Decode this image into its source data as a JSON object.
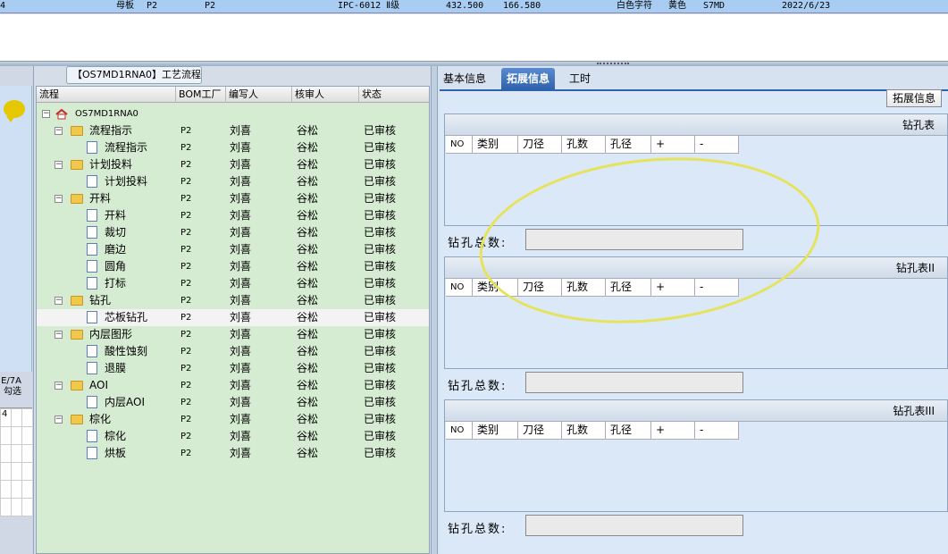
{
  "top_row": {
    "c0": "4",
    "c1": "母板",
    "c2": "P2",
    "c3": "P2",
    "c4": "IPC-6012 Ⅱ级",
    "c5": "432.500",
    "c6": "166.580",
    "c7": "白色字符",
    "c8": "黄色",
    "c9": "S7MD",
    "c10": "2022/6/23"
  },
  "left_edge": {
    "label_line1": "E/7A",
    "label_line2": "勾选",
    "grid_header": "4"
  },
  "tree": {
    "title": "【OS7MD1RNA0】工艺流程",
    "columns": [
      "流程",
      "BOM工厂",
      "编写人",
      "核审人",
      "状态"
    ],
    "root": "OS7MD1RNA0",
    "rows": [
      {
        "level": 1,
        "name": "流程指示",
        "bom": "P2",
        "writer": "刘喜",
        "reviewer": "谷松",
        "status": "已审核"
      },
      {
        "level": 2,
        "name": "流程指示",
        "bom": "P2",
        "writer": "刘喜",
        "reviewer": "谷松",
        "status": "已审核"
      },
      {
        "level": 1,
        "name": "计划投料",
        "bom": "P2",
        "writer": "刘喜",
        "reviewer": "谷松",
        "status": "已审核"
      },
      {
        "level": 2,
        "name": "计划投料",
        "bom": "P2",
        "writer": "刘喜",
        "reviewer": "谷松",
        "status": "已审核"
      },
      {
        "level": 1,
        "name": "开料",
        "bom": "P2",
        "writer": "刘喜",
        "reviewer": "谷松",
        "status": "已审核"
      },
      {
        "level": 2,
        "name": "开料",
        "bom": "P2",
        "writer": "刘喜",
        "reviewer": "谷松",
        "status": "已审核"
      },
      {
        "level": 2,
        "name": "裁切",
        "bom": "P2",
        "writer": "刘喜",
        "reviewer": "谷松",
        "status": "已审核"
      },
      {
        "level": 2,
        "name": "磨边",
        "bom": "P2",
        "writer": "刘喜",
        "reviewer": "谷松",
        "status": "已审核"
      },
      {
        "level": 2,
        "name": "圆角",
        "bom": "P2",
        "writer": "刘喜",
        "reviewer": "谷松",
        "status": "已审核"
      },
      {
        "level": 2,
        "name": "打标",
        "bom": "P2",
        "writer": "刘喜",
        "reviewer": "谷松",
        "status": "已审核"
      },
      {
        "level": 1,
        "name": "钻孔",
        "bom": "P2",
        "writer": "刘喜",
        "reviewer": "谷松",
        "status": "已审核"
      },
      {
        "level": 2,
        "name": "芯板钻孔",
        "bom": "P2",
        "writer": "刘喜",
        "reviewer": "谷松",
        "status": "已审核",
        "selected": true
      },
      {
        "level": 1,
        "name": "内层图形",
        "bom": "P2",
        "writer": "刘喜",
        "reviewer": "谷松",
        "status": "已审核"
      },
      {
        "level": 2,
        "name": "酸性蚀刻",
        "bom": "P2",
        "writer": "刘喜",
        "reviewer": "谷松",
        "status": "已审核"
      },
      {
        "level": 2,
        "name": "退膜",
        "bom": "P2",
        "writer": "刘喜",
        "reviewer": "谷松",
        "status": "已审核"
      },
      {
        "level": 1,
        "name": "AOI",
        "bom": "P2",
        "writer": "刘喜",
        "reviewer": "谷松",
        "status": "已审核"
      },
      {
        "level": 2,
        "name": "内层AOI",
        "bom": "P2",
        "writer": "刘喜",
        "reviewer": "谷松",
        "status": "已审核"
      },
      {
        "level": 1,
        "name": "棕化",
        "bom": "P2",
        "writer": "刘喜",
        "reviewer": "谷松",
        "status": "已审核"
      },
      {
        "level": 2,
        "name": "棕化",
        "bom": "P2",
        "writer": "刘喜",
        "reviewer": "谷松",
        "status": "已审核"
      },
      {
        "level": 2,
        "name": "烘板",
        "bom": "P2",
        "writer": "刘喜",
        "reviewer": "谷松",
        "status": "已审核"
      }
    ]
  },
  "tabs": [
    "基本信息",
    "拓展信息",
    "工时"
  ],
  "active_tab": "拓展信息",
  "ext_button": "拓展信息",
  "drill_tables": [
    {
      "title": "钻孔表",
      "total_label": "钻孔总数:",
      "total_value": ""
    },
    {
      "title": "钻孔表II",
      "total_label": "钻孔总数:",
      "total_value": ""
    },
    {
      "title": "钻孔表III",
      "total_label": "钻孔总数:",
      "total_value": ""
    }
  ],
  "drill_columns": [
    "NO",
    "类别",
    "刀径",
    "孔数",
    "孔径",
    "+",
    "-"
  ],
  "colors": {
    "tree_bg": "#d6ecd2",
    "tab_active": "#2f63ad",
    "highlight_ellipse": "#e6e35a"
  }
}
